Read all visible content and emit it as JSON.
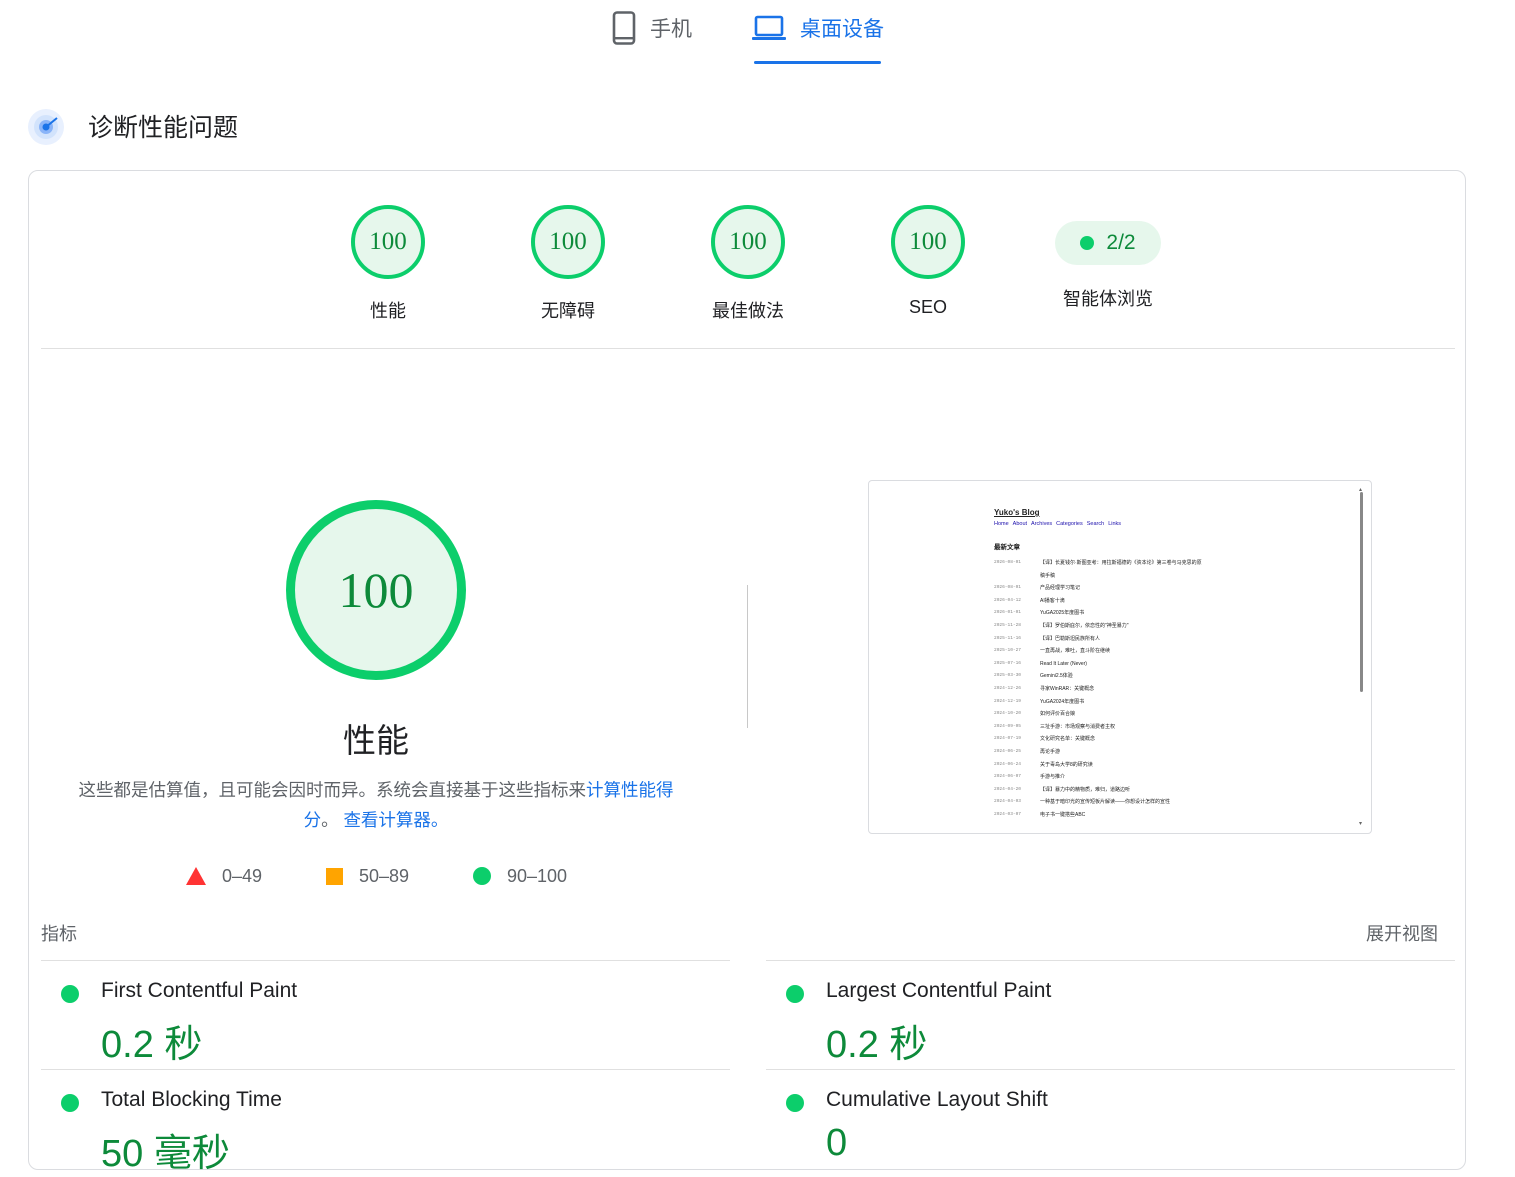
{
  "tabs": [
    {
      "label": "手机",
      "icon": "phone-icon",
      "active": false
    },
    {
      "label": "桌面设备",
      "icon": "laptop-icon",
      "active": true
    }
  ],
  "section": {
    "title": "诊断性能问题",
    "icon": "diagnose-gauge-icon"
  },
  "scores": [
    {
      "value": "100",
      "label": "性能"
    },
    {
      "value": "100",
      "label": "无障碍"
    },
    {
      "value": "100",
      "label": "最佳做法"
    },
    {
      "value": "100",
      "label": "SEO"
    }
  ],
  "agent": {
    "value": "2/2",
    "label": "智能体浏览"
  },
  "performance": {
    "score": "100",
    "title": "性能",
    "desc_prefix": "这些都是估算值，且可能会因时而异。系统会直接基于这些指标来",
    "link1": "计算性能得分",
    "sep": "。",
    "link2": "查看计算器。"
  },
  "legend": [
    {
      "range": "0–49",
      "shape": "triangle",
      "color": "#ff3333"
    },
    {
      "range": "50–89",
      "shape": "square",
      "color": "#ffa400"
    },
    {
      "range": "90–100",
      "shape": "circle",
      "color": "#0cce6b"
    }
  ],
  "thumbnail": {
    "title": "Yuko's Blog",
    "nav": [
      "Home",
      "About",
      "Archives",
      "Categories",
      "Search",
      "Links"
    ],
    "heading": "最新文章",
    "posts": [
      {
        "date": "2026-08-01",
        "text": "【译】长夏钱尔·斯图亚考：用拉斯福德的《资本论》第三卷与马克思的原"
      },
      {
        "date": "",
        "text": "稿手稿"
      },
      {
        "date": "2026-08-01",
        "text": "产品经理学习笔记"
      },
      {
        "date": "2026-04-12",
        "text": "AI播客十滴"
      },
      {
        "date": "2026-01-01",
        "text": "YuGA2025年度图书"
      },
      {
        "date": "2025-11-28",
        "text": "【译】罗伯斯庇尔，依恋性的\"神圣暴力\""
      },
      {
        "date": "2025-11-16",
        "text": "【译】巴勒斯坦民族所有人"
      },
      {
        "date": "2025-10-27",
        "text": "一直再战，难吐，直斗阶在继续"
      },
      {
        "date": "2025-07-16",
        "text": "Read It Later (Never)"
      },
      {
        "date": "2025-03-30",
        "text": "Gemini2.5体验"
      },
      {
        "date": "2024-12-26",
        "text": "寻家WinRAR：关键概念"
      },
      {
        "date": "2024-12-19",
        "text": "YuGA2024年度图书"
      },
      {
        "date": "2024-10-20",
        "text": "如何评价百合娘"
      },
      {
        "date": "2024-09-05",
        "text": "三址手游：市场观察与消费者主权"
      },
      {
        "date": "2024-07-19",
        "text": "文化研究名单：关键概念"
      },
      {
        "date": "2024-06-25",
        "text": "再论手游"
      },
      {
        "date": "2024-06-24",
        "text": "关于毒岛大学8的研究读"
      },
      {
        "date": "2024-06-07",
        "text": "手游与推介"
      },
      {
        "date": "2024-04-20",
        "text": "【译】暴力中的精物质，难归，道路边听"
      },
      {
        "date": "2024-04-03",
        "text": "一种基于暗印光的宣传短板片解读——你想设计怎样的宣性"
      },
      {
        "date": "2024-03-07",
        "text": "电子书一键搭些ABC"
      }
    ]
  },
  "metrics_header": {
    "label": "指标",
    "expand": "展开视图"
  },
  "metrics": [
    {
      "name": "First Contentful Paint",
      "value": "0.2 秒"
    },
    {
      "name": "Largest Contentful Paint",
      "value": "0.2 秒"
    },
    {
      "name": "Total Blocking Time",
      "value": "50 毫秒"
    },
    {
      "name": "Cumulative Layout Shift",
      "value": "0"
    }
  ],
  "colors": {
    "accent": "#1a73e8",
    "pass": "#0cce6b",
    "pass_text": "#0d8a3a",
    "pass_bg": "#e6f7ec",
    "average": "#ffa400",
    "fail": "#ff3333"
  }
}
